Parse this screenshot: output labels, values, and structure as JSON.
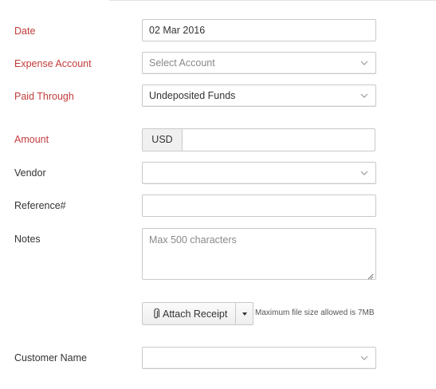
{
  "form": {
    "date": {
      "label": "Date",
      "value": "02 Mar 2016"
    },
    "expense_account": {
      "label": "Expense Account",
      "placeholder": "Select Account"
    },
    "paid_through": {
      "label": "Paid Through",
      "value": "Undeposited Funds"
    },
    "amount": {
      "label": "Amount",
      "currency": "USD",
      "value": ""
    },
    "vendor": {
      "label": "Vendor",
      "value": ""
    },
    "reference": {
      "label": "Reference#",
      "value": ""
    },
    "notes": {
      "label": "Notes",
      "placeholder": "Max 500 characters"
    },
    "attach": {
      "button_label": "Attach Receipt",
      "hint": "Maximum file size allowed is 7MB"
    },
    "customer": {
      "label": "Customer Name",
      "value": ""
    }
  },
  "colors": {
    "required_label": "#c23b3b",
    "border": "#c9c9c9",
    "placeholder": "#8a8a8a"
  },
  "icons": [
    "chevron-down-icon",
    "paperclip-icon",
    "caret-down-icon",
    "resize-handle-icon"
  ]
}
